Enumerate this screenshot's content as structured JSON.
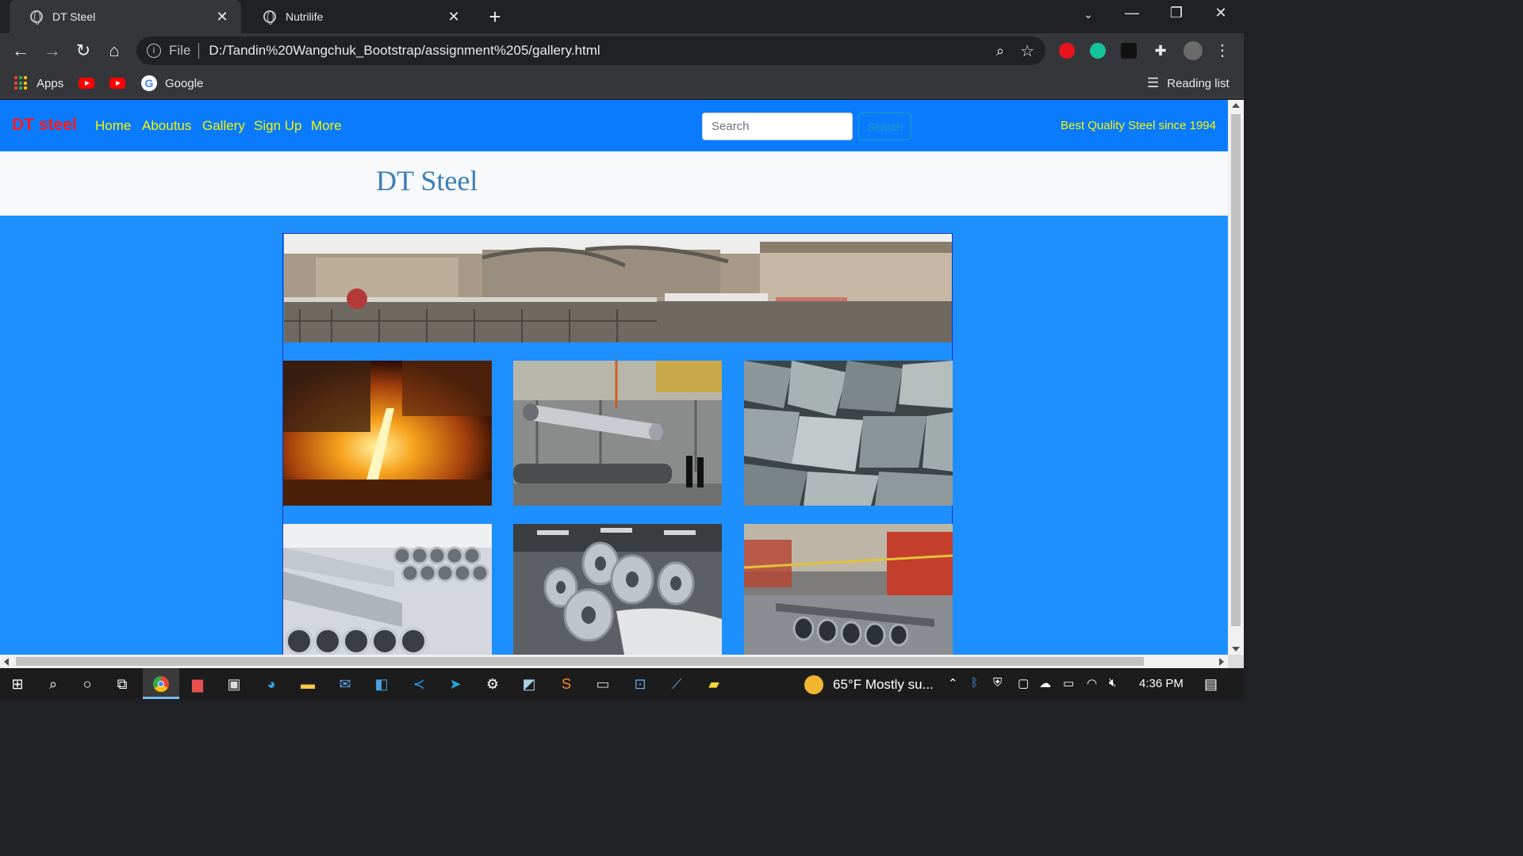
{
  "browser": {
    "tabs": [
      {
        "title": "DT Steel",
        "active": true
      },
      {
        "title": "Nutrilife",
        "active": false
      }
    ],
    "address": {
      "scheme": "File",
      "url": "D:/Tandin%20Wangchuk_Bootstrap/assignment%205/gallery.html"
    },
    "bookmarks": {
      "apps": "Apps",
      "google": "Google",
      "reading_list": "Reading list"
    }
  },
  "navbar": {
    "brand": "DT steel",
    "links": [
      "Home",
      "Aboutus",
      "Gallery",
      "Sign Up",
      "More"
    ],
    "search_placeholder": "Search",
    "search_button": "Search",
    "tagline": "Best Quality Steel since 1994"
  },
  "hero": {
    "title": "DT Steel"
  },
  "gallery": {
    "banner": "steel-plant-exterior-photo",
    "photos": [
      "molten-steel-pouring-photo",
      "steel-pipe-crane-factory-photo",
      "iron-ore-rocks-photo",
      "stacked-steel-pipes-photo",
      "steel-coils-warehouse-photo",
      "pipe-factory-interior-photo"
    ]
  },
  "taskbar": {
    "weather": "65°F  Mostly su...",
    "time": "4:36 PM"
  },
  "colors": {
    "page_background": "#1e8fff",
    "navbar": "#0a7bff",
    "brand": "#ff1a1a",
    "nav_links": "#f5f500",
    "hero_title": "#3a7fb6",
    "search_button": "#17a2b8"
  }
}
